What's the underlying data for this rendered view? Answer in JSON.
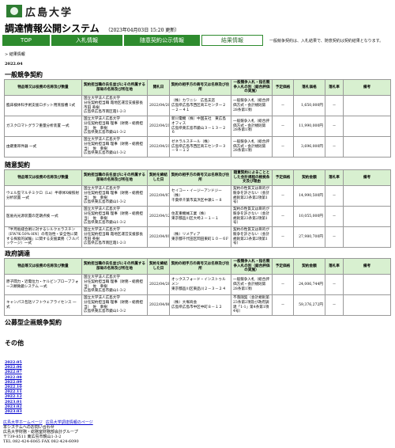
{
  "header": {
    "university": "広島大学",
    "title": "調達情報公開システム",
    "updated": "（2023年04月03日 15:20 更新）"
  },
  "nav": {
    "tabs": [
      "TOP",
      "入札情報",
      "随意契約公示情報",
      "結果情報"
    ],
    "active_index": 3,
    "note": "一般競争契約は、入札結果で、随意契約は契約結果となります。"
  },
  "breadcrumb": "> 結果情報",
  "year_month": "2022.04",
  "sections": {
    "general": "一般競争契約",
    "negotiated": "随意契約",
    "govt": "政府調達",
    "public_plan": "公募型企画競争契約",
    "other": "その他"
  },
  "general_table": {
    "headers": [
      "物品等又は役務の名称及び数量",
      "契約担当職の氏名並びにその所属する部局の名称及び所在地",
      "開札日",
      "契約の相手方の商号又は名称及び住所",
      "一般競争入札・指名競争入札の別（総合評価の実施）",
      "予定価格",
      "落札価格",
      "落札率",
      "備考"
    ],
    "rows": [
      {
        "name": "臨床検体科手術支援ロボット用蒸留槽 1式",
        "officer": "国立大学法人広島大学\n分任契約担当職 霞地区運営支援部長　市田 英樹\n広島県広島市南区霞1-2-3",
        "date": "2022/04/20",
        "vendor": "（株）カワニシ　広島支店\n広島県広島市西区商工センター２－２－４１",
        "type": "一般競争入札（総合評価方式・会計規則第28条第1項）",
        "estimate": "－",
        "price": "1,650,000円",
        "rate": "－",
        "note": ""
      },
      {
        "name": "ガスクロマトグラフ重量分析装置 一式",
        "officer": "国立大学法人広島大学\n分任契約担当職 理事（財務・総務担当）　佐　幸樹\n広島県東広島市鏡山1-3-2",
        "date": "2022/04/21",
        "vendor": "新川電機（株）中国支社　東広島オフィス\n広島県東広島市鏡山３－１３－２６",
        "type": "一般競争入札（総合評価方式・会計規則第28条第1項）",
        "estimate": "－",
        "price": "11,990,000円",
        "rate": "－",
        "note": ""
      },
      {
        "name": "由鍵重帯件器 一式",
        "officer": "国立大学法人広島大学\n分任契約担当職 理事（財務・総務担当）　佐　幸樹\n広島県東広島市鏡山1-3-2",
        "date": "2022/04/21",
        "vendor": "ゼネラルスチール（株）\n広島県広島市西区商工センター３－９－１２",
        "type": "一般競争入札（総合評価方式・会計規則第28条第1項）",
        "estimate": "－",
        "price": "3,696,000円",
        "rate": "－",
        "note": ""
      }
    ]
  },
  "negotiated_table": {
    "headers": [
      "物品等又は役務の名称及び数量",
      "契約担当職の氏名並びにその所属する部局の名称及び所在地",
      "契約を締結した日",
      "契約の相手方の商号又は名称及び住所",
      "随意契約によることとした会計規程の根拠条文及び理由",
      "予定価格",
      "契約金額",
      "落札率",
      "備考"
    ],
    "rows": [
      {
        "name": "ウェル型マルチミクロ（Lu）半導体X線照射分析装置 一式",
        "officer": "国立大学法人広島大学\n分任契約担当職 理事（財務・総務担当）　佐　幸樹\n広島県東広島市鏡山1-3-2",
        "date": "2022/04/07",
        "vendor": "セイコー・イージーアンドジー（株）\n千葉県千葉市美浜区中瀬１－８",
        "type": "契約の性質又は目的が競争を許さない（会計規則第23条第2項第1号）",
        "estimate": "－",
        "price": "14,990,500円",
        "rate": "－",
        "note": ""
      },
      {
        "name": "医歯光光源装置の定期点検 一式",
        "officer": "国立大学法人広島大学\n分任契約担当職 理事（財務・総務担当）　佐　幸樹\n広島県東広島市鏡山1-3-2",
        "date": "2022/04/12",
        "vendor": "住友重機械工業（株）\n東京都品川区大崎２－１－１",
        "type": "契約の性質又は目的が競争を許さない（会計規則第23条第2項第1号）",
        "estimate": "－",
        "price": "10,055,000円",
        "rate": "－",
        "note": ""
      },
      {
        "name": "「半月板縫合術に対するシルクエラスチン（EW?K-50%-HN）の有効性・安全性に関する探索的試験」に関する支援業務（フルパッケージ）一式",
        "officer": "国立大学法人広島大学\n分任契約担当職 霞地区運営支援部長　市田 英樹\n広島県広島市南区霞1-2-3",
        "date": "2022/04/01",
        "vendor": "（株）リメディア\n東京都千代田区岡田東町１０－６F",
        "type": "契約の性質又は目的が競争を許さない（会計規則第23条第2項第1号）",
        "estimate": "－",
        "price": "27,980,700円",
        "rate": "－",
        "note": ""
      }
    ]
  },
  "govt_table": {
    "headers": [
      "物品等又は役務の名称及び数量",
      "契約担当職の氏名並びにその所属する部局の名称及び所在地",
      "契約を締結した日",
      "契約の相手方の商号又は名称及び住所",
      "一般競争入札・指名競争入札の別（総合評価の実施）",
      "予定価格",
      "契約金額",
      "落札率",
      "備考"
    ],
    "rows": [
      {
        "name": "原子間力・近電位力・ケルビンプローブフォース顕微鏡システム 一式",
        "officer": "国立大学法人広島大学\n分任契約担当職 理事（財務・総務担当）　佐　幸樹\n広島県東広島市鏡山1-3-2",
        "date": "2022/04/28",
        "vendor": "オックスフォード・インストゥルメン\n東京都品川区東品川２－３－２４",
        "type": "一般競争入札（総合評価方式・会計規則第28条第1項）",
        "estimate": "－",
        "price": "24,006,744円",
        "rate": "－",
        "note": ""
      },
      {
        "name": "キャンパス包括ソフトウェアライセンス 一式",
        "officer": "国立大学法人広島大学\n分任契約担当職 理事（財務・総務担当）　佐　幸樹\n広島県東広島市鏡山1-3-2",
        "date": "2022/04/06",
        "vendor": "（株）大塚商会\n広島県広島市中区中町８－１２",
        "type": "不落随契（会計規則第23条第2項及び政府調達「1-1」第4条第1項4号）",
        "estimate": "－",
        "price": "59,376,272円",
        "rate": "－",
        "note": ""
      }
    ]
  },
  "months": [
    "2022.05",
    "2022.06",
    "2022.07",
    "2022.08",
    "2022.09",
    "2022.10",
    "2022.11",
    "2022.12",
    "2023.01",
    "2023.02",
    "2023.03"
  ],
  "footer": {
    "links": [
      "広島大学ホームページ",
      "広島大学調達情報のページ"
    ],
    "lines": [
      "本システムへのお問い合わせ",
      "広島大学財務・総務室財務部会計グループ",
      "〒739-8511 東広島市鏡山1-3-2",
      "TEL 082-424-6065 FAX 082-424-6090"
    ]
  }
}
